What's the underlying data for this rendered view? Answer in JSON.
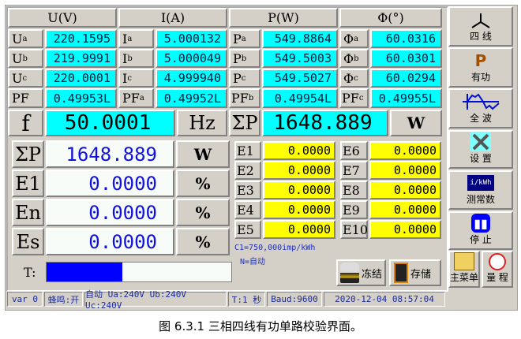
{
  "headers": {
    "u": "U(V)",
    "i": "I(A)",
    "p": "P(W)",
    "phi": "Φ(°)"
  },
  "rows": [
    {
      "ul": "U",
      "us": "a",
      "u": "220.1595",
      "il": "I",
      "is": "a",
      "i": "5.000132",
      "pl": "P",
      "ps": "a",
      "p": "549.8864",
      "fl": "Φ",
      "fs": "a",
      "f": "60.0316"
    },
    {
      "ul": "U",
      "us": "b",
      "u": "219.9991",
      "il": "I",
      "is": "b",
      "i": "5.000049",
      "pl": "P",
      "ps": "b",
      "p": "549.5003",
      "fl": "Φ",
      "fs": "b",
      "f": "60.0301"
    },
    {
      "ul": "U",
      "us": "c",
      "u": "220.0001",
      "il": "I",
      "is": "c",
      "i": "4.999940",
      "pl": "P",
      "ps": "c",
      "p": "549.5027",
      "fl": "Φ",
      "fs": "c",
      "f": "60.0294"
    }
  ],
  "pf": {
    "label": "PF",
    "value": "0.49953L",
    "a_label": "PF",
    "a_sub": "a",
    "a": "0.49952L",
    "b_label": "PF",
    "b_sub": "b",
    "b": "0.49954L",
    "c_label": "PF",
    "c_sub": "c",
    "c": "0.49955L"
  },
  "freq": {
    "label": "f",
    "value": "50.0001",
    "unit": "Hz",
    "sum_label": "ΣP",
    "sum_value": "1648.889",
    "sum_unit": "W"
  },
  "meas": [
    {
      "label": "ΣP",
      "value": "1648.889",
      "unit": "W"
    },
    {
      "label": "E1",
      "value": "0.0000",
      "unit": "%"
    },
    {
      "label": "En",
      "value": "0.0000",
      "unit": "%"
    },
    {
      "label": "Es",
      "value": "0.0000",
      "unit": "%"
    }
  ],
  "progress": {
    "label": "T:",
    "percent": 41,
    "color": "#0000ff"
  },
  "errors": [
    {
      "label": "E1",
      "value": "0.0000"
    },
    {
      "label": "E6",
      "value": "0.0000"
    },
    {
      "label": "E2",
      "value": "0.0000"
    },
    {
      "label": "E7",
      "value": "0.0000"
    },
    {
      "label": "E3",
      "value": "0.0000"
    },
    {
      "label": "E8",
      "value": "0.0000"
    },
    {
      "label": "E4",
      "value": "0.0000"
    },
    {
      "label": "E9",
      "value": "0.0000"
    },
    {
      "label": "E5",
      "value": "0.0000"
    },
    {
      "label": "E10",
      "value": "0.0000"
    }
  ],
  "const_text": "C1=750,000imp/kWh",
  "n_text": "N=自动",
  "buttons": {
    "freeze": "冻结",
    "save": "存储"
  },
  "side": {
    "wire": "四 线",
    "active_icon": "P",
    "active": "有功",
    "wave": "全 波",
    "settings": "设 置",
    "const_icon": "i/kWh",
    "const": "测常数",
    "stop": "停 止",
    "menu": "主菜单",
    "range": "量 程"
  },
  "status": {
    "var": "var 0",
    "buzzer": "蜂鸣:开",
    "auto": "自动 Ua:240V Ub:240V Uc:240V",
    "t": "T:1 秒",
    "baud": "Baud:9600",
    "datetime": "2020-12-04 08:57:04"
  },
  "caption": "图 6.3.1 三相四线有功单路校验界面。",
  "colors": {
    "cyan": "#00ffff",
    "yellow": "#ffff00",
    "panel": "#d4d0c8",
    "blue_text": "#1010e0"
  }
}
